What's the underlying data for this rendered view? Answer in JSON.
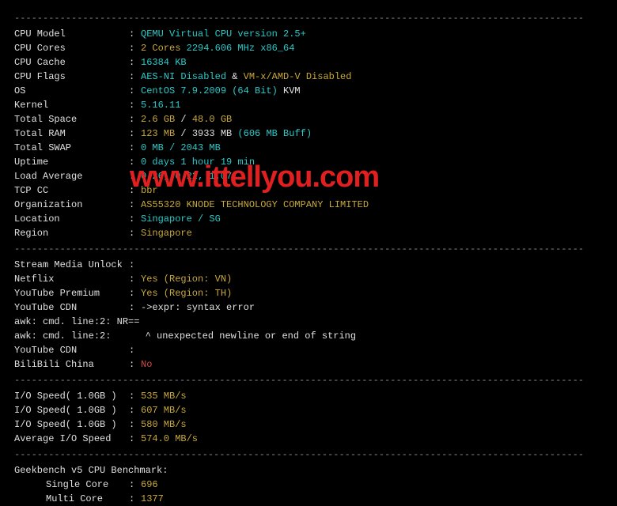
{
  "divider": "----------------------------------------------------------------------------------------------------",
  "sysinfo": [
    {
      "label": "CPU Model",
      "segs": [
        {
          "t": "QEMU Virtual CPU version 2.5+",
          "c": "cyan"
        }
      ]
    },
    {
      "label": "CPU Cores",
      "segs": [
        {
          "t": "2 Cores",
          "c": "yellow"
        },
        {
          "t": " 2294.606 MHz x86_64",
          "c": "cyan"
        }
      ]
    },
    {
      "label": "CPU Cache",
      "segs": [
        {
          "t": "16384 KB",
          "c": "cyan"
        }
      ]
    },
    {
      "label": "CPU Flags",
      "segs": [
        {
          "t": "AES-NI Disabled",
          "c": "cyan"
        },
        {
          "t": " & ",
          "c": "white"
        },
        {
          "t": "VM-x/AMD-V Disabled",
          "c": "yellow"
        }
      ]
    },
    {
      "label": "OS",
      "segs": [
        {
          "t": "CentOS 7.9.2009 (64 Bit) ",
          "c": "cyan"
        },
        {
          "t": "KVM",
          "c": "white"
        }
      ]
    },
    {
      "label": "Kernel",
      "segs": [
        {
          "t": "5.16.11",
          "c": "cyan"
        }
      ]
    },
    {
      "label": "Total Space",
      "segs": [
        {
          "t": "2.6 GB",
          "c": "yellow"
        },
        {
          "t": " / ",
          "c": "white"
        },
        {
          "t": "48.0 GB",
          "c": "yellow"
        }
      ]
    },
    {
      "label": "Total RAM",
      "segs": [
        {
          "t": "123 MB",
          "c": "yellow"
        },
        {
          "t": " / 3933 MB ",
          "c": "white"
        },
        {
          "t": "(606 MB Buff)",
          "c": "cyan"
        }
      ]
    },
    {
      "label": "Total SWAP",
      "segs": [
        {
          "t": "0 MB / 2043 MB",
          "c": "cyan"
        }
      ]
    },
    {
      "label": "Uptime",
      "segs": [
        {
          "t": "0 days 1 hour 19 min",
          "c": "cyan"
        }
      ]
    },
    {
      "label": "Load Average",
      "segs": [
        {
          "t": "0.26, 0.22, 1.07",
          "c": "cyan"
        }
      ]
    },
    {
      "label": "TCP CC",
      "segs": [
        {
          "t": "bbr",
          "c": "yellow"
        }
      ]
    },
    {
      "label": "Organization",
      "segs": [
        {
          "t": "AS55320 KNODE TECHNOLOGY COMPANY LIMITED",
          "c": "yellow"
        }
      ]
    },
    {
      "label": "Location",
      "segs": [
        {
          "t": "Singapore / SG",
          "c": "cyan"
        }
      ]
    },
    {
      "label": "Region",
      "segs": [
        {
          "t": "Singapore",
          "c": "yellow"
        }
      ]
    }
  ],
  "media": {
    "header": "Stream Media Unlock",
    "rows": [
      {
        "label": "Netflix",
        "segs": [
          {
            "t": "Yes (Region: VN)",
            "c": "yellow"
          }
        ]
      },
      {
        "label": "YouTube Premium",
        "segs": [
          {
            "t": "Yes (Region: TH)",
            "c": "yellow"
          }
        ]
      },
      {
        "label": "YouTube CDN",
        "segs": [
          {
            "t": "->expr: syntax error",
            "c": "white"
          }
        ]
      }
    ],
    "err1": "awk: cmd. line:2: NR==",
    "err2": "awk: cmd. line:2:      ^ unexpected newline or end of string",
    "rows2": [
      {
        "label": "YouTube CDN",
        "segs": [
          {
            "t": "",
            "c": "white"
          }
        ]
      },
      {
        "label": "BiliBili China",
        "segs": [
          {
            "t": "No",
            "c": "red"
          }
        ]
      }
    ]
  },
  "io": [
    {
      "label": "I/O Speed( 1.0GB )",
      "val": "535 MB/s"
    },
    {
      "label": "I/O Speed( 1.0GB )",
      "val": "607 MB/s"
    },
    {
      "label": "I/O Speed( 1.0GB )",
      "val": "580 MB/s"
    },
    {
      "label": "Average I/O Speed",
      "val": "574.0 MB/s"
    }
  ],
  "geekbench": {
    "header": "Geekbench v5 CPU Benchmark:",
    "rows": [
      {
        "label": "Single Core",
        "val": "696"
      },
      {
        "label": "Multi Core",
        "val": "1377"
      }
    ]
  },
  "watermark": "www.ittellyou.com"
}
